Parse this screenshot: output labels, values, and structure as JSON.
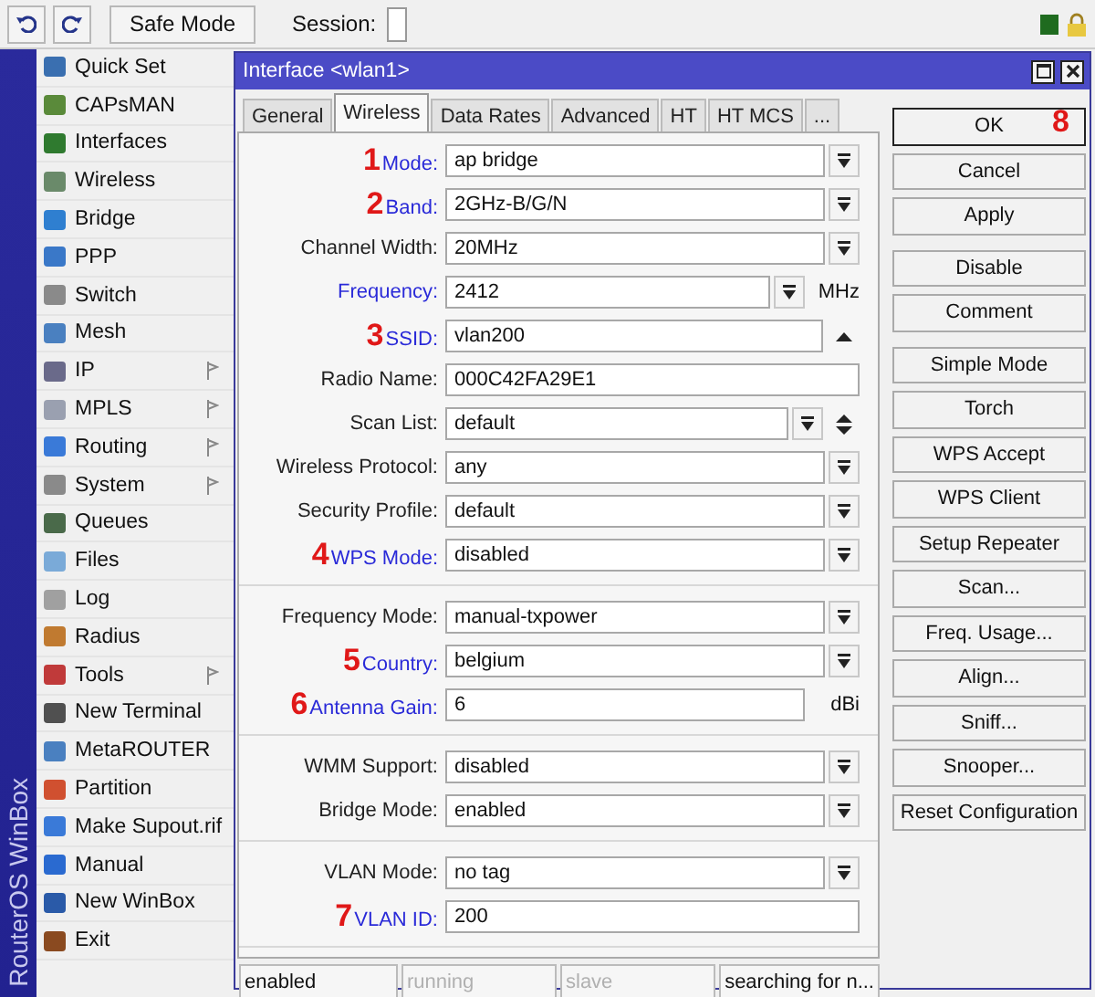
{
  "toolbar": {
    "safe_mode": "Safe Mode",
    "session_label": "Session:"
  },
  "sidebar": {
    "brand": "RouterOS WinBox",
    "items": [
      {
        "label": "Quick Set",
        "submenu": false
      },
      {
        "label": "CAPsMAN",
        "submenu": false
      },
      {
        "label": "Interfaces",
        "submenu": false
      },
      {
        "label": "Wireless",
        "submenu": false
      },
      {
        "label": "Bridge",
        "submenu": false
      },
      {
        "label": "PPP",
        "submenu": false
      },
      {
        "label": "Switch",
        "submenu": false
      },
      {
        "label": "Mesh",
        "submenu": false
      },
      {
        "label": "IP",
        "submenu": true
      },
      {
        "label": "MPLS",
        "submenu": true
      },
      {
        "label": "Routing",
        "submenu": true
      },
      {
        "label": "System",
        "submenu": true
      },
      {
        "label": "Queues",
        "submenu": false
      },
      {
        "label": "Files",
        "submenu": false
      },
      {
        "label": "Log",
        "submenu": false
      },
      {
        "label": "Radius",
        "submenu": false
      },
      {
        "label": "Tools",
        "submenu": true
      },
      {
        "label": "New Terminal",
        "submenu": false
      },
      {
        "label": "MetaROUTER",
        "submenu": false
      },
      {
        "label": "Partition",
        "submenu": false
      },
      {
        "label": "Make Supout.rif",
        "submenu": false
      },
      {
        "label": "Manual",
        "submenu": false
      },
      {
        "label": "New WinBox",
        "submenu": false
      },
      {
        "label": "Exit",
        "submenu": false
      }
    ]
  },
  "dialog": {
    "title": "Interface <wlan1>",
    "tabs": [
      {
        "label": "General",
        "selected": false
      },
      {
        "label": "Wireless",
        "selected": true
      },
      {
        "label": "Data Rates",
        "selected": false
      },
      {
        "label": "Advanced",
        "selected": false
      },
      {
        "label": "HT",
        "selected": false
      },
      {
        "label": "HT MCS",
        "selected": false
      },
      {
        "label": "...",
        "selected": false
      }
    ],
    "groups": [
      {
        "fields": [
          {
            "marker": "1",
            "label": "Mode:",
            "highlighted": true,
            "kind": "dropdown",
            "value": "ap bridge"
          },
          {
            "marker": "2",
            "label": "Band:",
            "highlighted": true,
            "kind": "dropdown",
            "value": "2GHz-B/G/N"
          },
          {
            "label": "Channel Width:",
            "highlighted": false,
            "kind": "dropdown",
            "value": "20MHz"
          },
          {
            "label": "Frequency:",
            "highlighted": true,
            "kind": "dropdown",
            "value": "2412",
            "unit": "MHz"
          },
          {
            "marker": "3",
            "label": "SSID:",
            "highlighted": true,
            "kind": "expandable",
            "value": "vlan200"
          },
          {
            "label": "Radio Name:",
            "highlighted": false,
            "kind": "text",
            "value": "000C42FA29E1"
          },
          {
            "label": "Scan List:",
            "highlighted": false,
            "kind": "scan",
            "value": "default"
          },
          {
            "label": "Wireless Protocol:",
            "highlighted": false,
            "kind": "dropdown",
            "value": "any"
          },
          {
            "label": "Security Profile:",
            "highlighted": false,
            "kind": "dropdown",
            "value": "default"
          },
          {
            "marker": "4",
            "label": "WPS Mode:",
            "highlighted": true,
            "kind": "dropdown",
            "value": "disabled"
          }
        ]
      },
      {
        "fields": [
          {
            "label": "Frequency Mode:",
            "highlighted": false,
            "kind": "dropdown",
            "value": "manual-txpower"
          },
          {
            "marker": "5",
            "label": "Country:",
            "highlighted": true,
            "kind": "dropdown",
            "value": "belgium"
          },
          {
            "marker": "6",
            "label": "Antenna Gain:",
            "highlighted": true,
            "kind": "text",
            "value": "6",
            "unit": "dBi"
          }
        ]
      },
      {
        "fields": [
          {
            "label": "WMM Support:",
            "highlighted": false,
            "kind": "dropdown",
            "value": "disabled"
          },
          {
            "label": "Bridge Mode:",
            "highlighted": false,
            "kind": "dropdown",
            "value": "enabled"
          }
        ]
      },
      {
        "fields": [
          {
            "label": "VLAN Mode:",
            "highlighted": false,
            "kind": "dropdown",
            "value": "no tag"
          },
          {
            "marker": "7",
            "label": "VLAN ID:",
            "highlighted": true,
            "kind": "text",
            "value": "200"
          }
        ]
      }
    ],
    "button_groups": [
      [
        {
          "label": "OK",
          "focused": true,
          "marker": "8"
        },
        {
          "label": "Cancel",
          "focused": false
        },
        {
          "label": "Apply",
          "focused": false
        }
      ],
      [
        {
          "label": "Disable",
          "focused": false
        },
        {
          "label": "Comment",
          "focused": false
        }
      ],
      [
        {
          "label": "Simple Mode",
          "focused": false
        },
        {
          "label": "Torch",
          "focused": false
        },
        {
          "label": "WPS Accept",
          "focused": false
        },
        {
          "label": "WPS Client",
          "focused": false
        },
        {
          "label": "Setup Repeater",
          "focused": false
        },
        {
          "label": "Scan...",
          "focused": false
        },
        {
          "label": "Freq. Usage...",
          "focused": false
        },
        {
          "label": "Align...",
          "focused": false
        },
        {
          "label": "Sniff...",
          "focused": false
        },
        {
          "label": "Snooper...",
          "focused": false
        },
        {
          "label": "Reset Configuration",
          "focused": false
        }
      ]
    ],
    "status_bar": [
      {
        "text": "enabled",
        "greyed": false
      },
      {
        "text": "running",
        "greyed": true
      },
      {
        "text": "slave",
        "greyed": true
      },
      {
        "text": "searching for n...",
        "greyed": false
      }
    ]
  }
}
